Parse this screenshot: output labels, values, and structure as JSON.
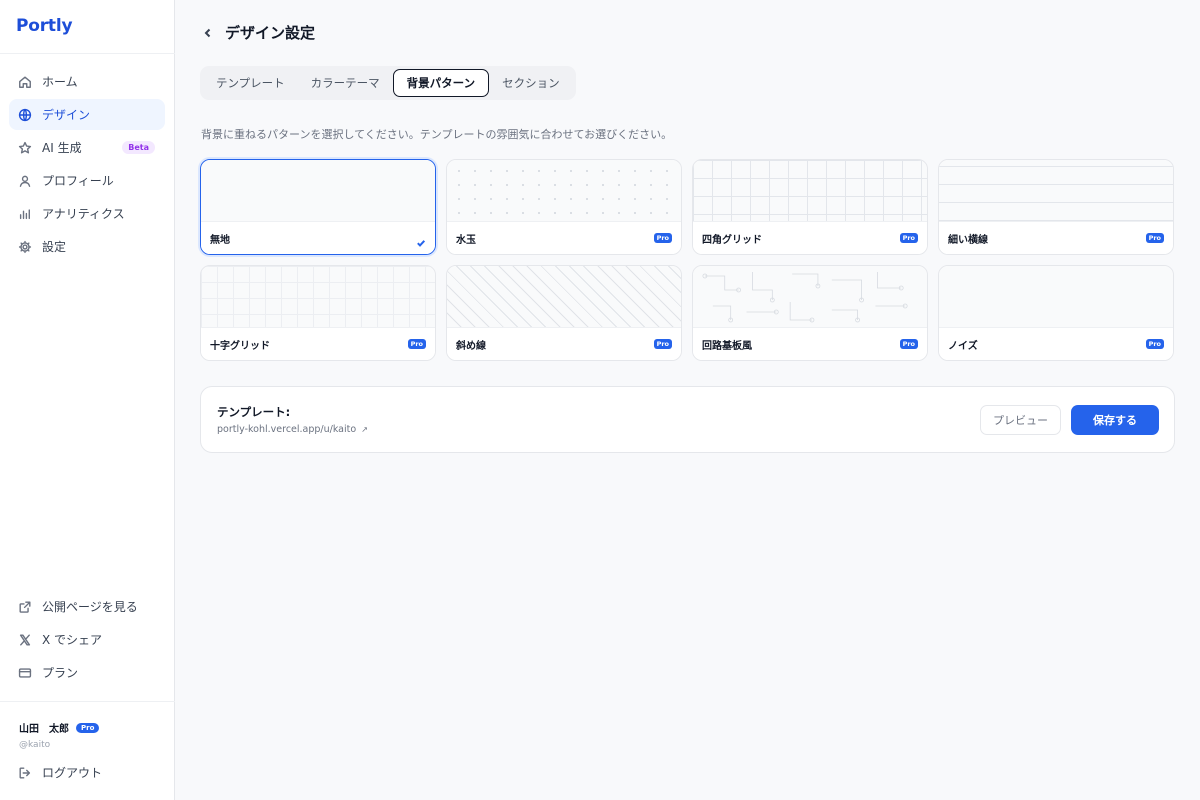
{
  "sidebar": {
    "brand": "Portly",
    "nav": [
      {
        "label": "ホーム",
        "icon": "home-icon"
      },
      {
        "label": "デザイン",
        "icon": "globe-icon",
        "active": true
      },
      {
        "label": "AI 生成",
        "icon": "star-icon",
        "badge": "Beta"
      },
      {
        "label": "プロフィール",
        "icon": "user-icon"
      },
      {
        "label": "アナリティクス",
        "icon": "bar-chart-icon"
      },
      {
        "label": "設定",
        "icon": "gear-icon"
      }
    ],
    "bottom_nav": [
      {
        "label": "公開ページを見る",
        "icon": "external-link-icon"
      },
      {
        "label": "X でシェア",
        "icon": "x-logo-icon"
      },
      {
        "label": "プラン",
        "icon": "credit-card-icon"
      }
    ],
    "user": {
      "name": "山田　太郎",
      "plan_badge": "Pro",
      "handle": "@kaito"
    },
    "logout": {
      "label": "ログアウト",
      "icon": "logout-icon"
    }
  },
  "header": {
    "title": "デザイン設定"
  },
  "tabs": [
    {
      "label": "テンプレート"
    },
    {
      "label": "カラーテーマ"
    },
    {
      "label": "背景パターン",
      "active": true
    },
    {
      "label": "セクション"
    }
  ],
  "description": "背景に重ねるパターンを選択してください。テンプレートの雰囲気に合わせてお選びください。",
  "patterns": [
    {
      "label": "無地",
      "selected": true
    },
    {
      "label": "水玉",
      "badge": "Pro"
    },
    {
      "label": "四角グリッド",
      "badge": "Pro"
    },
    {
      "label": "細い横線",
      "badge": "Pro"
    },
    {
      "label": "十字グリッド",
      "badge": "Pro"
    },
    {
      "label": "斜め線",
      "badge": "Pro"
    },
    {
      "label": "回路基板風",
      "badge": "Pro"
    },
    {
      "label": "ノイズ",
      "badge": "Pro"
    }
  ],
  "save_bar": {
    "title": "テンプレート:",
    "url": "portly-kohl.vercel.app/u/kaito",
    "url_icon": "↗",
    "preview_label": "プレビュー",
    "save_label": "保存する"
  },
  "colors": {
    "accent": "#2563eb",
    "brand": "#1d4ed8",
    "beta": "#9333ea"
  }
}
